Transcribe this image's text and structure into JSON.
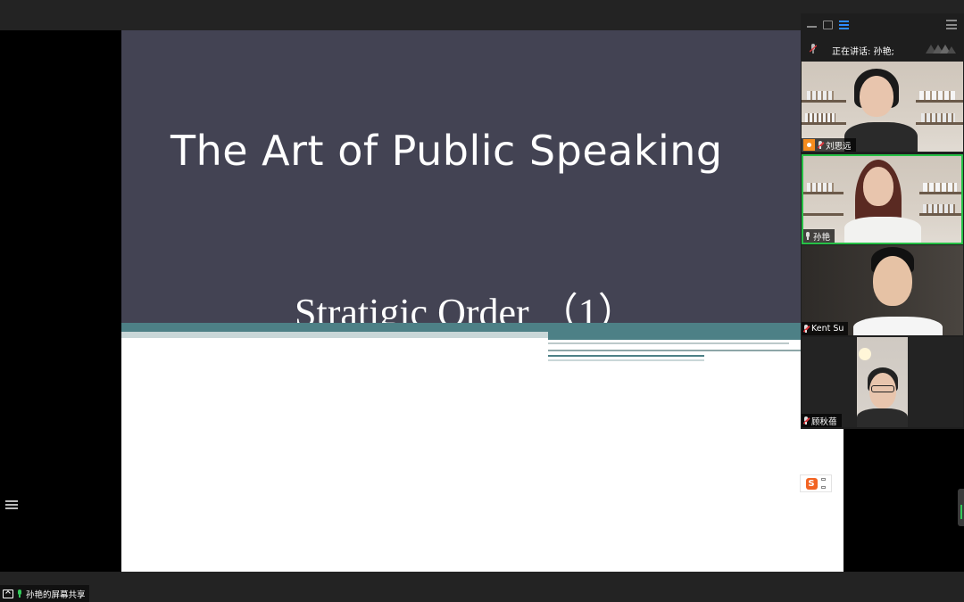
{
  "slide": {
    "title": "The Art of Public Speaking",
    "subtitle": "Stratigic Order （1）"
  },
  "video_panel": {
    "speaking_label": "正在讲话: 孙艳;",
    "participants": [
      {
        "name": "刘思远",
        "muted": true,
        "video_on": true
      },
      {
        "name": "孙艳",
        "muted": false,
        "video_on": true,
        "active_speaker": true
      },
      {
        "name": "Kent Su",
        "muted": true,
        "video_on": true
      },
      {
        "name": "顾秋蓓",
        "muted": true,
        "video_on": true
      }
    ]
  },
  "share_indicator": {
    "label": "孙艳的屏幕共享"
  },
  "colors": {
    "slide_dark": "#434353",
    "slide_teal": "#4d8086",
    "active_speaker_border": "#27c046",
    "muted_red": "#e0383e",
    "sogou_orange": "#f26322"
  },
  "icons": {
    "sogou_ime": "S"
  }
}
